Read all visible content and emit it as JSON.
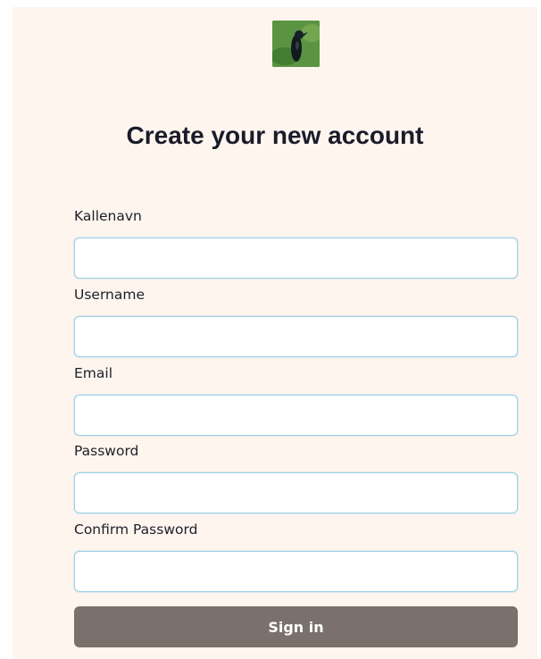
{
  "logo": {
    "icon": "bird-photo-icon"
  },
  "heading": "Create your new account",
  "fields": [
    {
      "label": "Kallenavn",
      "value": "",
      "placeholder": ""
    },
    {
      "label": "Username",
      "value": "",
      "placeholder": ""
    },
    {
      "label": "Email",
      "value": "",
      "placeholder": ""
    },
    {
      "label": "Password",
      "value": "",
      "placeholder": ""
    },
    {
      "label": "Confirm Password",
      "value": "",
      "placeholder": ""
    }
  ],
  "submit": {
    "label": "Sign in"
  },
  "colors": {
    "panel_background": "#fdf5ee",
    "title_text": "#1a1b2a",
    "input_border": "#9fd0e6",
    "button_background": "#7b716c",
    "button_text": "#ffffff"
  }
}
